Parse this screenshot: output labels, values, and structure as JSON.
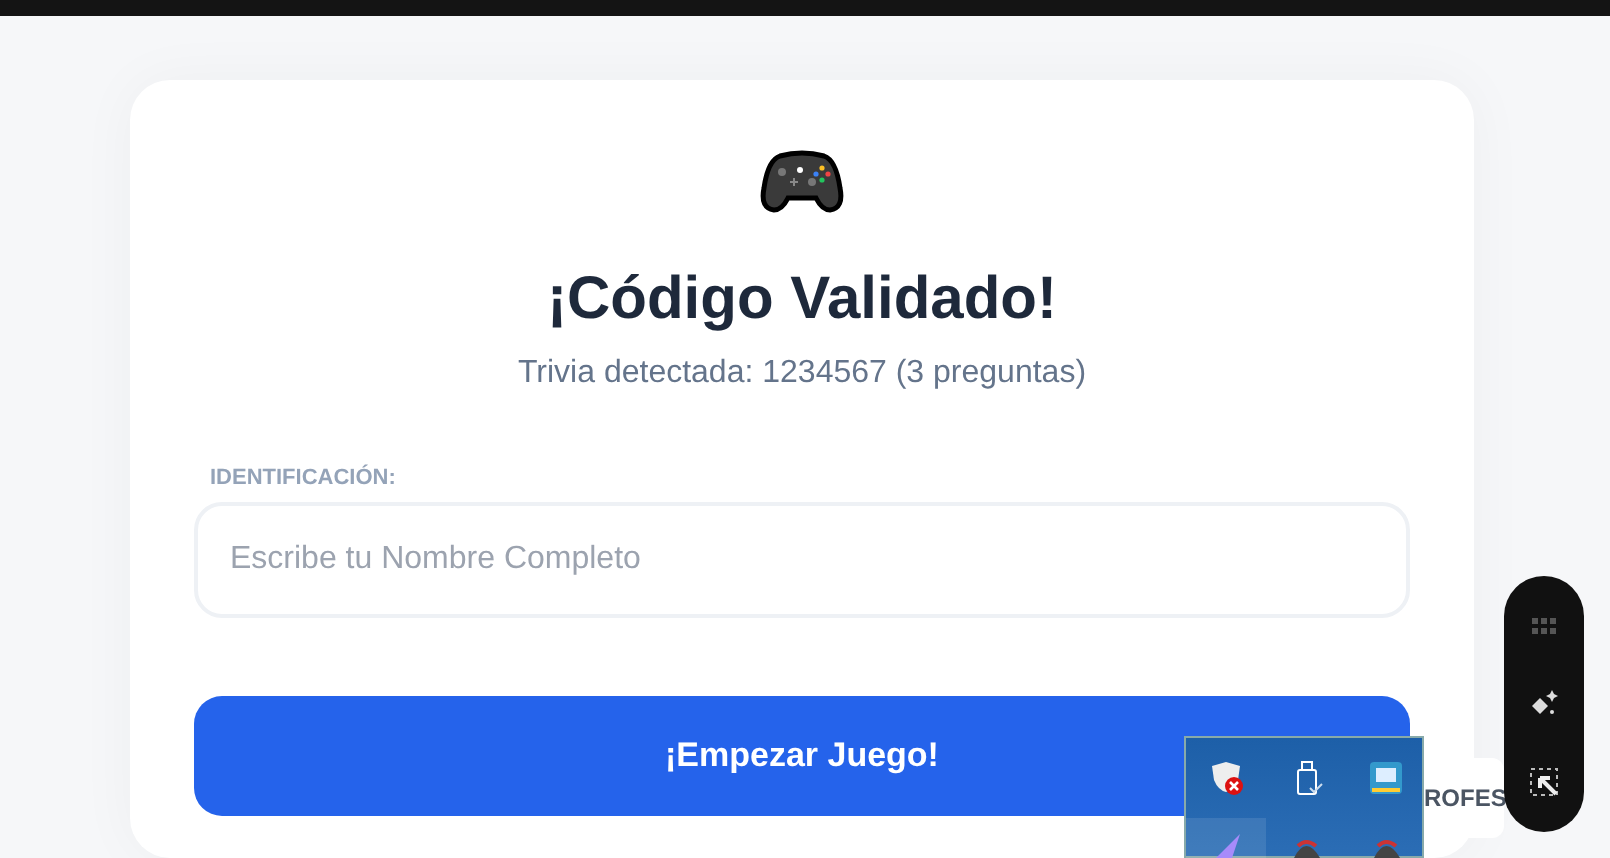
{
  "card": {
    "title": "¡Código Validado!",
    "subtitle": "Trivia detectada: 1234567 (3 preguntas)",
    "field_label": "IDENTIFICACIÓN:",
    "name_field": {
      "placeholder": "Escribe tu Nombre Completo"
    },
    "start_button": "¡Empezar Juego!"
  },
  "behind_button": "ROFES"
}
